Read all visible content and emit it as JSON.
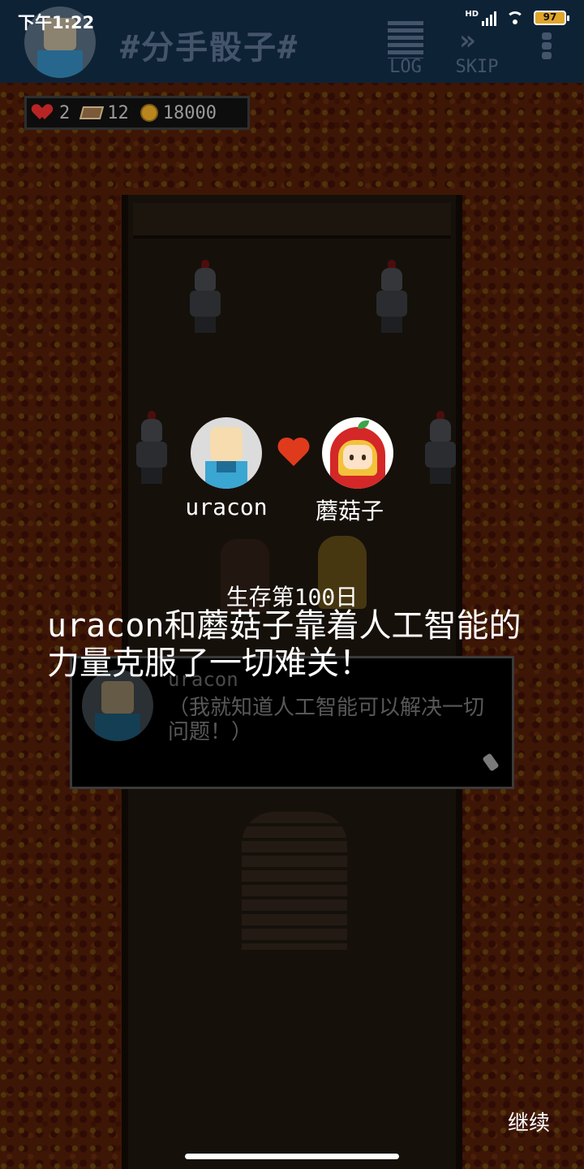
{
  "status_bar": {
    "time": "下午1:22",
    "network": "HD",
    "battery": "97"
  },
  "header": {
    "title": "#分手骰子#",
    "log_label": "LOG",
    "skip_label": "SKIP"
  },
  "resources": {
    "hearts": "2",
    "books": "12",
    "coins": "18000"
  },
  "ending": {
    "player1_name": "uracon",
    "player2_name": "蘑菇子",
    "day_text": "生存第100日",
    "message": "uracon和蘑菇子靠着人工智能的力量克服了一切难关！"
  },
  "dialog": {
    "speaker": "uracon",
    "line": "（我就知道人工智能可以解决一切问题！）"
  },
  "footer": {
    "continue_label": "继续"
  },
  "colors": {
    "top_bar": "#0e2236",
    "heart": "#e03a1c",
    "lava": "#a33a12"
  }
}
